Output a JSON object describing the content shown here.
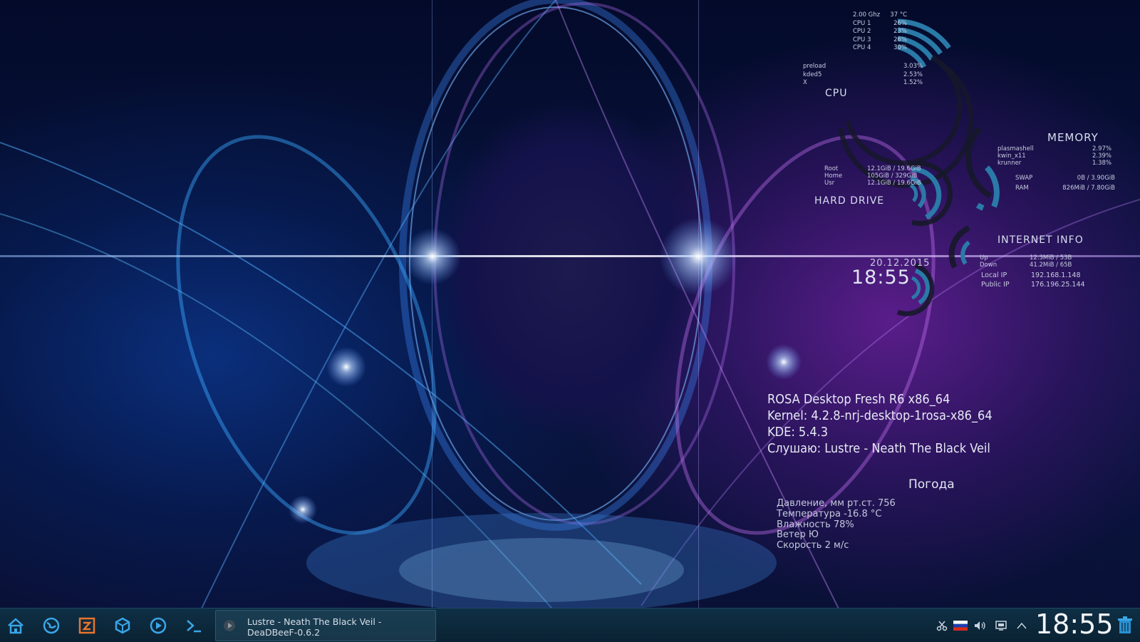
{
  "conky": {
    "cpu": {
      "freq": "2.00 Ghz",
      "temp": "37 °C",
      "cores": [
        {
          "name": "CPU 1",
          "value": "26%"
        },
        {
          "name": "CPU 2",
          "value": "23%"
        },
        {
          "name": "CPU 3",
          "value": "26%"
        },
        {
          "name": "CPU 4",
          "value": "30%"
        }
      ],
      "processes": [
        {
          "name": "preload",
          "value": "3.03%"
        },
        {
          "name": "kded5",
          "value": "2.53%"
        },
        {
          "name": "X",
          "value": "1.52%"
        }
      ],
      "title": "CPU"
    },
    "memory": {
      "title": "MEMORY",
      "processes": [
        {
          "name": "plasmashell",
          "value": "2.97%"
        },
        {
          "name": "kwin_x11",
          "value": "2.39%"
        },
        {
          "name": "krunner",
          "value": "1.38%"
        }
      ],
      "swap_label": "SWAP",
      "swap_value": "0B  / 3.90GiB",
      "ram_label": "RAM",
      "ram_value": "826MiB / 7.80GiB"
    },
    "hard_drive": {
      "title": "HARD DRIVE",
      "rows": [
        {
          "name": "Root",
          "value": "12.1GiB / 19.6GiB"
        },
        {
          "name": "Home",
          "value": "105GiB / 329GiB"
        },
        {
          "name": "Usr",
          "value": "12.1GiB / 19.6GiB"
        }
      ]
    },
    "internet": {
      "title": "INTERNET INFO",
      "rows": [
        {
          "name": "Up",
          "value": "12.3MiB / 53B"
        },
        {
          "name": "Down",
          "value": "41.2MiB / 65B"
        },
        {
          "name": "Local IP",
          "value": "192.168.1.148"
        },
        {
          "name": "Public IP",
          "value": "176.196.25.144"
        }
      ]
    },
    "date": "20.12.2015",
    "time": "18:55"
  },
  "sysinfo": {
    "line1": "ROSA Desktop Fresh R6    x86_64",
    "line2": "Kernel:  4.2.8-nrj-desktop-1rosa-x86_64",
    "line3": "KDE:  5.4.3",
    "line4": "Слушаю: Lustre - Neath The Black Veil"
  },
  "weather": {
    "title": "Погода",
    "lines": [
      "Давление, мм рт.ст. 756",
      "Температура -16.8 °C",
      "Влажность 78%",
      "Ветер Ю",
      "Скорость 2 м/с"
    ]
  },
  "taskbar": {
    "launchers": [
      "home-icon",
      "browser-icon",
      "filezilla-icon",
      "package-icon",
      "media-player-icon",
      "terminal-icon"
    ],
    "task_title_line1": "Lustre - Neath The Black Veil -",
    "task_title_line2": "DeaDBeeF-0.6.2",
    "tray": [
      "scissors-icon",
      "russian-flag-icon",
      "volume-icon",
      "network-icon",
      "arrow-up-icon"
    ],
    "clock": "18:55"
  },
  "colors": {
    "accent": "#2a7aa8",
    "ring_dark": "#14192b",
    "taskbar": "#0c2638"
  }
}
